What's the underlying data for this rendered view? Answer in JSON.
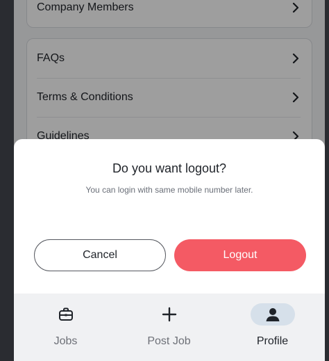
{
  "settings": {
    "company_members": "Company Members",
    "faqs": "FAQs",
    "terms": "Terms & Conditions",
    "guidelines": "Guidelines"
  },
  "dialog": {
    "title": "Do you want logout?",
    "subtitle": "You can login with same mobile number later.",
    "cancel_label": "Cancel",
    "logout_label": "Logout"
  },
  "tabs": [
    {
      "label": "Jobs",
      "icon": "briefcase-icon",
      "active": false
    },
    {
      "label": "Post Job",
      "icon": "plus-icon",
      "active": false
    },
    {
      "label": "Profile",
      "icon": "person-icon",
      "active": true
    }
  ],
  "colors": {
    "logout_button": "#f45a64",
    "active_tab_pill": "#d6e0ea",
    "overlay": "rgba(0,0,0,0.38)"
  }
}
